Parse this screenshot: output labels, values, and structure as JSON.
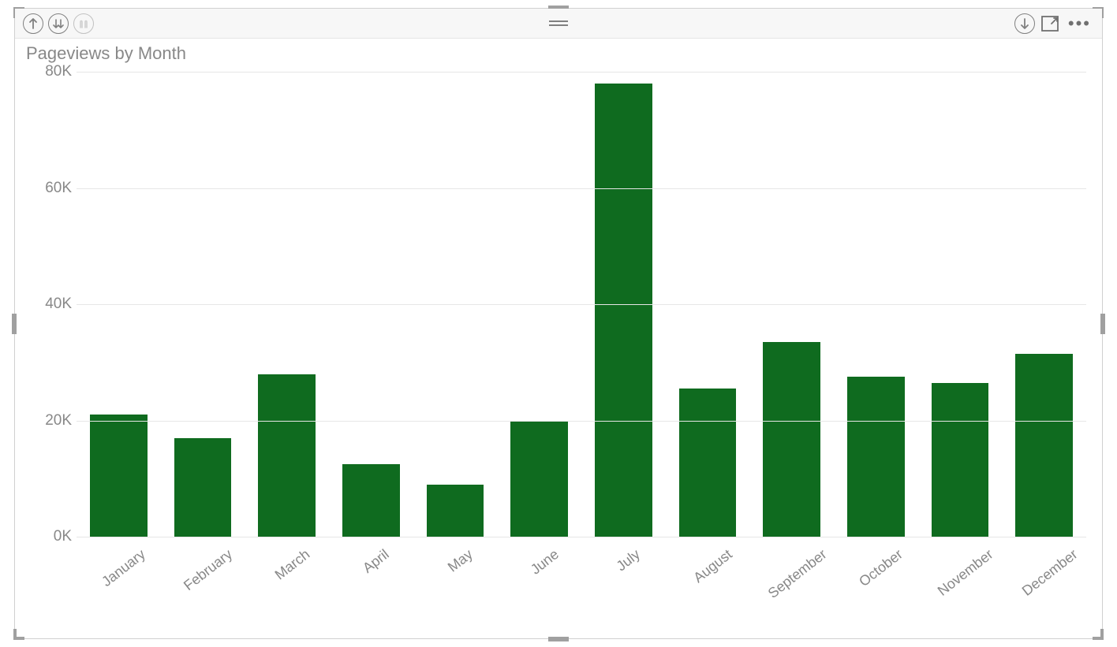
{
  "chart_data": {
    "type": "bar",
    "title": "Pageviews by Month",
    "categories": [
      "January",
      "February",
      "March",
      "April",
      "May",
      "June",
      "July",
      "August",
      "September",
      "October",
      "November",
      "December"
    ],
    "values": [
      21000,
      17000,
      28000,
      12500,
      9000,
      20000,
      78000,
      25500,
      33500,
      27500,
      26500,
      31500
    ],
    "xlabel": "",
    "ylabel": "",
    "ylim": [
      0,
      80000
    ],
    "yticks": [
      0,
      20000,
      40000,
      60000,
      80000
    ],
    "ytick_labels": [
      "0K",
      "20K",
      "40K",
      "60K",
      "80K"
    ],
    "bar_color": "#0f6b1f"
  },
  "toolbar": {
    "drill_up": "Drill up",
    "drill_down": "Drill down",
    "drill_expand": "Expand all down one level",
    "export": "Export data",
    "focus": "Focus mode",
    "more": "More options"
  }
}
